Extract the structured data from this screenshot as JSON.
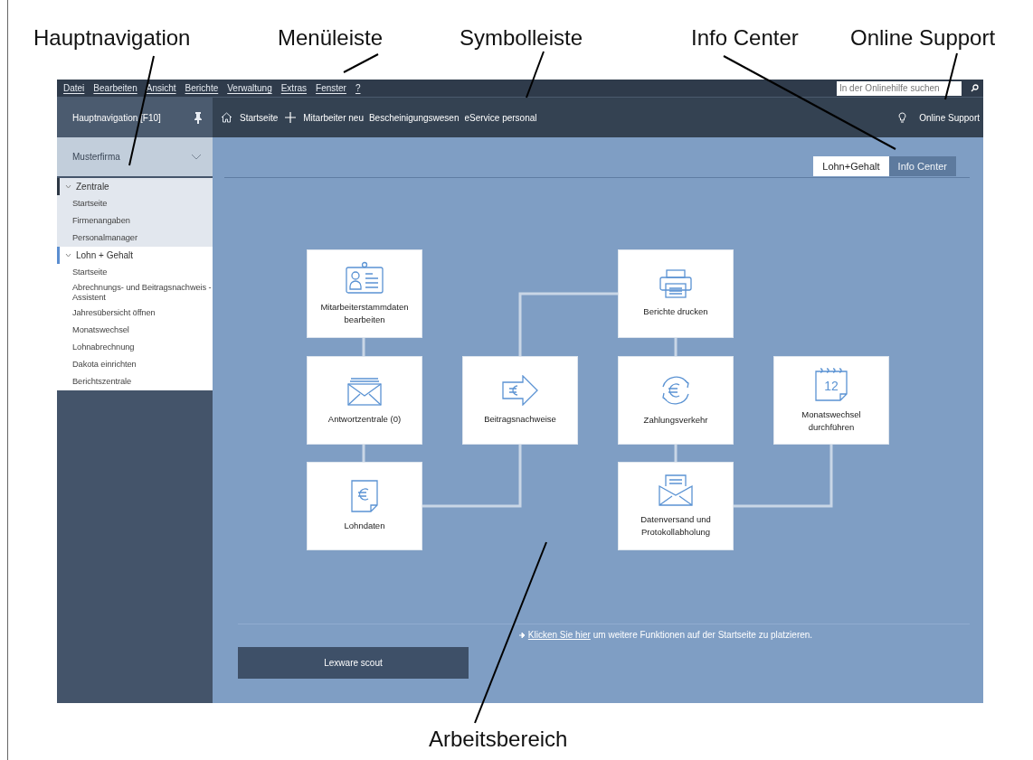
{
  "annotations": [
    {
      "label": "Hauptnavigation"
    },
    {
      "label": "Menüleiste"
    },
    {
      "label": "Symbolleiste"
    },
    {
      "label": "Info Center"
    },
    {
      "label": "Online Support"
    },
    {
      "label": "Arbeitsbereich"
    }
  ],
  "menu": [
    "Datei",
    "Bearbeiten",
    "Ansicht",
    "Berichte",
    "Verwaltung",
    "Extras",
    "Fenster",
    "?"
  ],
  "search": {
    "placeholder": "In der Onlinehilfe suchen"
  },
  "sidebar": {
    "title": "Hauptnavigation [F10]",
    "company": "Musterfirma",
    "groups": [
      {
        "label": "Zentrale",
        "expanded": true,
        "selected": false,
        "children": [
          "Startseite",
          "Firmenangaben",
          "Personalmanager"
        ]
      },
      {
        "label": "Lohn + Gehalt",
        "expanded": true,
        "selected": true,
        "children": [
          "Startseite",
          "Abrechnungs- und Beitragsnachweis -Assistent",
          "Jahresübersicht öffnen",
          "Monatswechsel",
          "Lohnabrechnung",
          "Dakota einrichten",
          "Berichtszentrale"
        ]
      }
    ]
  },
  "toolbar": {
    "items": [
      "Startseite",
      "Mitarbeiter neu",
      "Bescheinigungswesen",
      "eService personal"
    ],
    "support": "Online Support"
  },
  "tabs": [
    {
      "label": "Lohn+Gehalt",
      "selected": true
    },
    {
      "label": "Info Center",
      "selected": false
    }
  ],
  "tiles": [
    {
      "label": "Mitarbeiterstammdaten bearbeiten"
    },
    {
      "label": "Antwortzentrale (0)"
    },
    {
      "label": "Lohndaten"
    },
    {
      "label": "Beitragsnachweise"
    },
    {
      "label": "Berichte drucken"
    },
    {
      "label": "Zahlungsverkehr"
    },
    {
      "label": "Datenversand und Protokollabholung"
    },
    {
      "label": "Monatswechsel durchführen",
      "icon_text": "12"
    }
  ],
  "footer": {
    "link": "Klicken Sie hier",
    "text": "um weitere Funktionen auf der Startseite zu platzieren.",
    "button": "Lexware scout"
  }
}
